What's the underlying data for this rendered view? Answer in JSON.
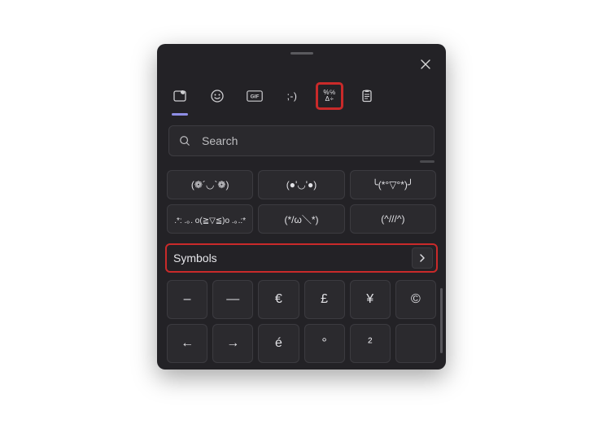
{
  "tabs": {
    "recent": "recent",
    "emoji": "emoji",
    "gif": "GIF",
    "kaomoji": ";-)",
    "symbols_line1": "%℅",
    "symbols_line2": "Δ÷",
    "clipboard": "clipboard"
  },
  "search": {
    "placeholder": "Search"
  },
  "kaomoji": {
    "items": [
      "(❁´◡`❁)",
      "(●'◡'●)",
      "╰(*°▽°*)╯",
      ".*: .｡. o(≧▽≦)o .｡.:*",
      "(*/ω＼*)",
      "(^///^)"
    ]
  },
  "section": {
    "title": "Symbols"
  },
  "symbols": {
    "items": [
      "–",
      "—",
      "€",
      "£",
      "¥",
      "©",
      "←",
      "→",
      "é",
      "°",
      "²",
      ""
    ]
  }
}
